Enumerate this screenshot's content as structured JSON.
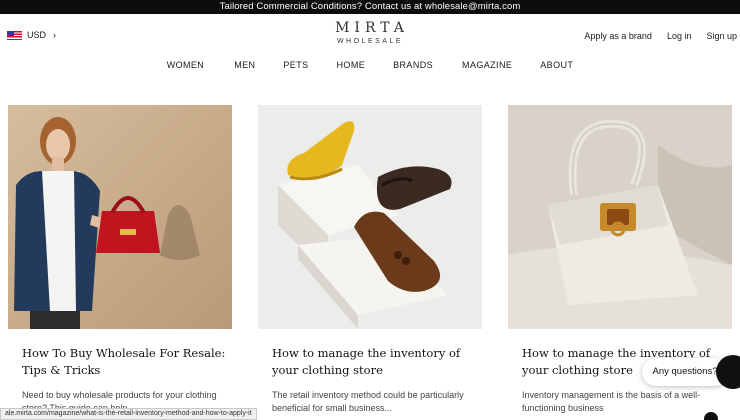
{
  "topbar": {
    "text": "Tailored Commercial Conditions? Contact us at wholesale@mirta.com"
  },
  "header": {
    "currency": "USD",
    "logo_main": "MIRTA",
    "logo_sub": "WHOLESALE",
    "account_links": [
      "Apply as a brand",
      "Log in",
      "Sign up"
    ]
  },
  "nav": [
    "WOMEN",
    "MEN",
    "PETS",
    "HOME",
    "BRANDS",
    "MAGAZINE",
    "ABOUT"
  ],
  "articles": [
    {
      "title": "How To Buy Wholesale For Resale: Tips & Tricks",
      "excerpt": "Need to buy wholesale products for your clothing store? This guide can help",
      "image": "woman-holding-red-handbag"
    },
    {
      "title": "How to manage the inventory of your clothing store",
      "excerpt": "The retail inventory method could be particularly beneficial for small business...",
      "image": "leather-shoes-on-blocks"
    },
    {
      "title": "How to manage the inventory of your clothing store",
      "excerpt": "Inventory management is the basis of a well-functioning business",
      "image": "white-leather-handbag"
    }
  ],
  "status_url": "ale.mirta.com/magazine/what-is-the-retail-inventory-method-and-how-to-apply-it",
  "chat": {
    "label": "Any questions?"
  }
}
